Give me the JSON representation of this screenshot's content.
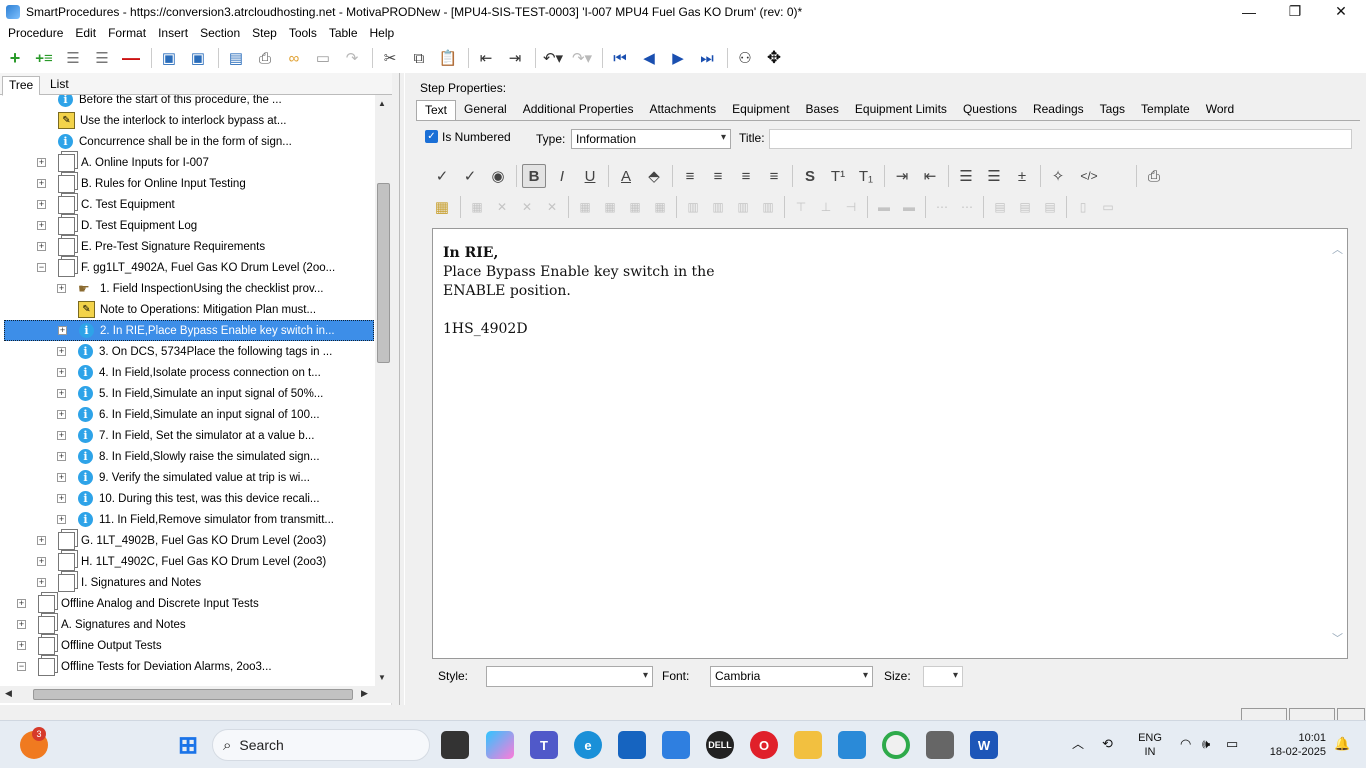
{
  "window": {
    "title": "SmartProcedures - https://conversion3.atrcloudhosting.net - MotivaPRODNew - [MPU4-SIS-TEST-0003] 'I-007 MPU4 Fuel Gas KO Drum' (rev: 0)*",
    "minimize": "—",
    "restore": "❐",
    "close": "✕"
  },
  "menu": [
    "Procedure",
    "Edit",
    "Format",
    "Insert",
    "Section",
    "Step",
    "Tools",
    "Table",
    "Help"
  ],
  "toolbar_icons": [
    "add-step-icon",
    "add-substep-icon",
    "indent-icon",
    "outdent-icon",
    "delete-icon",
    "save-icon",
    "save-all-icon",
    "print-preview-icon",
    "print-icon",
    "link-icon",
    "image-icon",
    "redo-disabled-icon",
    "cut-icon",
    "copy-icon",
    "paste-icon",
    "move-left-icon",
    "move-right-icon",
    "undo-icon",
    "redo-icon",
    "first-icon",
    "previous-icon",
    "next-icon",
    "last-icon",
    "binoculars-icon",
    "move-icon"
  ],
  "left_tabs": [
    "Tree",
    "List"
  ],
  "tree": [
    {
      "text": "Before the start of this procedure, the ...",
      "icon": "info",
      "expander": false,
      "level": 1
    },
    {
      "text": "Use the interlock to interlock bypass at...",
      "icon": "note",
      "expander": false,
      "level": 1
    },
    {
      "text": "Concurrence shall be in the form of sign...",
      "icon": "info",
      "expander": false,
      "level": 1
    },
    {
      "text": "A. Online Inputs for I-007",
      "icon": "page",
      "expander": "+",
      "level": 1
    },
    {
      "text": "B. Rules for Online Input Testing",
      "icon": "page",
      "expander": "+",
      "level": 1
    },
    {
      "text": "C. Test Equipment",
      "icon": "page",
      "expander": "+",
      "level": 1
    },
    {
      "text": "D. Test Equipment Log",
      "icon": "page",
      "expander": "+",
      "level": 1
    },
    {
      "text": "E. Pre-Test Signature Requirements",
      "icon": "page",
      "expander": "+",
      "level": 1
    },
    {
      "text": "F. gg1LT_4902A, Fuel Gas KO Drum Level (2oo...",
      "icon": "page",
      "expander": "−",
      "level": 1
    },
    {
      "text": "1. Field InspectionUsing the checklist prov...",
      "icon": "hand",
      "expander": "+",
      "level": 2
    },
    {
      "text": "Note to Operations: Mitigation Plan must...",
      "icon": "note",
      "expander": false,
      "level": 2
    },
    {
      "text": "2. In RIE,Place Bypass Enable key switch in...",
      "icon": "info",
      "expander": "+",
      "level": 2,
      "selected": true
    },
    {
      "text": "3. On DCS, 5734Place the following tags in ...",
      "icon": "info",
      "expander": "+",
      "level": 2
    },
    {
      "text": "4. In Field,Isolate process connection on t...",
      "icon": "info",
      "expander": "+",
      "level": 2
    },
    {
      "text": "5. In Field,Simulate an input signal of 50%...",
      "icon": "info",
      "expander": "+",
      "level": 2
    },
    {
      "text": "6. In Field,Simulate an input signal of 100...",
      "icon": "info",
      "expander": "+",
      "level": 2
    },
    {
      "text": "7. In Field, Set the simulator at a value b...",
      "icon": "info",
      "expander": "+",
      "level": 2
    },
    {
      "text": "8. In Field,Slowly raise the simulated sign...",
      "icon": "info",
      "expander": "+",
      "level": 2
    },
    {
      "text": "9. Verify the simulated value at trip is wi...",
      "icon": "info",
      "expander": "+",
      "level": 2
    },
    {
      "text": "10. During this test, was this device recali...",
      "icon": "info",
      "expander": "+",
      "level": 2
    },
    {
      "text": "11. In Field,Remove simulator from transmitt...",
      "icon": "info",
      "expander": "+",
      "level": 2
    },
    {
      "text": "G. 1LT_4902B, Fuel Gas KO Drum Level (2oo3)",
      "icon": "page",
      "expander": "+",
      "level": 1
    },
    {
      "text": "H. 1LT_4902C, Fuel Gas KO Drum Level (2oo3)",
      "icon": "page",
      "expander": "+",
      "level": 1
    },
    {
      "text": "I. Signatures and Notes",
      "icon": "page",
      "expander": "+",
      "level": 1
    },
    {
      "text": "Offline Analog and Discrete Input Tests",
      "icon": "page",
      "expander": "+",
      "level": 0
    },
    {
      "text": "A. Signatures and Notes",
      "icon": "page",
      "expander": "+",
      "level": 0
    },
    {
      "text": "Offline Output Tests",
      "icon": "page",
      "expander": "+",
      "level": 0
    },
    {
      "text": "Offline Tests for Deviation Alarms, 2oo3...",
      "icon": "page",
      "expander": "−",
      "level": 0
    }
  ],
  "step_properties": {
    "label": "Step Properties:",
    "tabs": [
      "Text",
      "General",
      "Additional Properties",
      "Attachments",
      "Equipment",
      "Bases",
      "Equipment Limits",
      "Questions",
      "Readings",
      "Tags",
      "Template",
      "Word"
    ],
    "is_numbered_label": "Is Numbered",
    "type_label": "Type:",
    "type_value": "Information",
    "title_label": "Title:",
    "title_value": "",
    "format_row1": [
      {
        "name": "spellcheck-icon",
        "glyph": "✓"
      },
      {
        "name": "spellcheck-options-icon",
        "glyph": "✓"
      },
      {
        "name": "comment-icon",
        "glyph": "◉"
      },
      {
        "name": "bold-icon",
        "glyph": "B"
      },
      {
        "name": "italic-icon",
        "glyph": "I"
      },
      {
        "name": "underline-icon",
        "glyph": "U"
      },
      {
        "name": "font-color-icon",
        "glyph": "A"
      },
      {
        "name": "highlight-icon",
        "glyph": "⬘"
      },
      {
        "name": "align-left-icon",
        "glyph": "≡"
      },
      {
        "name": "align-center-icon",
        "glyph": "≡"
      },
      {
        "name": "align-right-icon",
        "glyph": "≡"
      },
      {
        "name": "justify-icon",
        "glyph": "≡"
      },
      {
        "name": "strikethrough-icon",
        "glyph": "S"
      },
      {
        "name": "superscript-icon",
        "glyph": "T¹"
      },
      {
        "name": "subscript-icon",
        "glyph": "T₁"
      },
      {
        "name": "indent-icon",
        "glyph": "⇥"
      },
      {
        "name": "outdent-icon",
        "glyph": "⇤"
      },
      {
        "name": "bullet-list-icon",
        "glyph": "☰"
      },
      {
        "name": "numbered-list-icon",
        "glyph": "☰"
      },
      {
        "name": "insert-line-icon",
        "glyph": "±"
      },
      {
        "name": "magic-wand-icon",
        "glyph": "✧"
      },
      {
        "name": "html-code-icon",
        "glyph": "</>"
      },
      {
        "name": "printer-icon",
        "glyph": "⎙"
      }
    ],
    "editor_lines": [
      "In RIE,",
      "Place Bypass Enable key switch in the",
      "ENABLE position.",
      "",
      "1HS_4902D"
    ],
    "style_label": "Style:",
    "style_value": "",
    "font_label": "Font:",
    "font_value": "Cambria",
    "size_label": "Size:",
    "size_value": ""
  },
  "taskbar": {
    "search_placeholder": "Search",
    "badge_count": "3",
    "lang_top": "ENG",
    "lang_bottom": "IN",
    "time": "10:01",
    "date": "18-02-2025"
  },
  "colors": {
    "selection": "#3d8ee8",
    "info_icon": "#2ea3e8",
    "note_icon": "#f3d34a",
    "checkbox": "#1a6fd6"
  }
}
